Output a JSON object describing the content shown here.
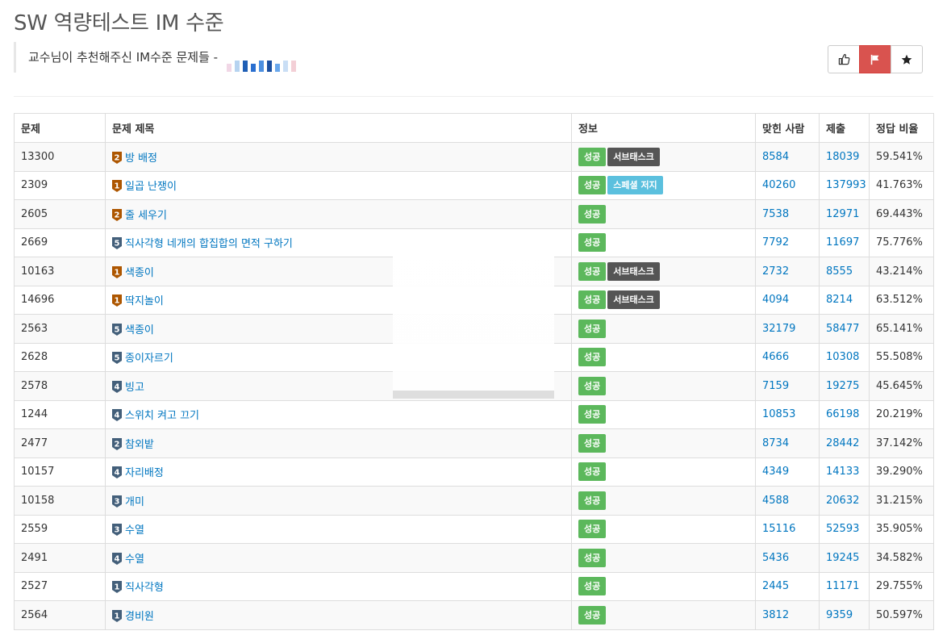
{
  "title": "SW 역량테스트 IM 수준",
  "description": "교수님이 추천해주신 IM수준 문제들 -",
  "redacted_colors": [
    "#f1d7e6",
    "#b6d3f0",
    "#1f5fb5",
    "#2a6fd0",
    "#4c8fe0",
    "#1b4fa0",
    "#6aa8ec",
    "#c9def5",
    "#f3cfd6"
  ],
  "actions": {
    "like_icon": "thumbs-up-icon",
    "flag_icon": "flag-icon",
    "star_icon": "star-icon",
    "flag_color": "#d9534f"
  },
  "columns": [
    "문제",
    "문제 제목",
    "정보",
    "맞힌 사람",
    "제출",
    "정답 비율"
  ],
  "tier_colors": {
    "bronze": "#ad5600",
    "silver": "#435f7a"
  },
  "problems": [
    {
      "id": "13300",
      "tier": "bronze",
      "level": "2",
      "title": "방 배정",
      "tags": [
        "성공",
        "서브태스크"
      ],
      "solved": "8584",
      "submissions": "18039",
      "ratio": "59.541%"
    },
    {
      "id": "2309",
      "tier": "bronze",
      "level": "1",
      "title": "일곱 난쟁이",
      "tags": [
        "성공",
        "스페셜 저지"
      ],
      "solved": "40260",
      "submissions": "137993",
      "ratio": "41.763%"
    },
    {
      "id": "2605",
      "tier": "bronze",
      "level": "2",
      "title": "줄 세우기",
      "tags": [
        "성공"
      ],
      "solved": "7538",
      "submissions": "12971",
      "ratio": "69.443%"
    },
    {
      "id": "2669",
      "tier": "silver",
      "level": "5",
      "title": "직사각형 네개의 합집합의 면적 구하기",
      "tags": [
        "성공"
      ],
      "solved": "7792",
      "submissions": "11697",
      "ratio": "75.776%"
    },
    {
      "id": "10163",
      "tier": "bronze",
      "level": "1",
      "title": "색종이",
      "tags": [
        "성공",
        "서브태스크"
      ],
      "solved": "2732",
      "submissions": "8555",
      "ratio": "43.214%"
    },
    {
      "id": "14696",
      "tier": "bronze",
      "level": "1",
      "title": "딱지놀이",
      "tags": [
        "성공",
        "서브태스크"
      ],
      "solved": "4094",
      "submissions": "8214",
      "ratio": "63.512%"
    },
    {
      "id": "2563",
      "tier": "silver",
      "level": "5",
      "title": "색종이",
      "tags": [
        "성공"
      ],
      "solved": "32179",
      "submissions": "58477",
      "ratio": "65.141%"
    },
    {
      "id": "2628",
      "tier": "silver",
      "level": "5",
      "title": "종이자르기",
      "tags": [
        "성공"
      ],
      "solved": "4666",
      "submissions": "10308",
      "ratio": "55.508%"
    },
    {
      "id": "2578",
      "tier": "silver",
      "level": "4",
      "title": "빙고",
      "tags": [
        "성공"
      ],
      "solved": "7159",
      "submissions": "19275",
      "ratio": "45.645%"
    },
    {
      "id": "1244",
      "tier": "silver",
      "level": "4",
      "title": "스위치 켜고 끄기",
      "tags": [
        "성공"
      ],
      "solved": "10853",
      "submissions": "66198",
      "ratio": "20.219%"
    },
    {
      "id": "2477",
      "tier": "silver",
      "level": "2",
      "title": "참외밭",
      "tags": [
        "성공"
      ],
      "solved": "8734",
      "submissions": "28442",
      "ratio": "37.142%"
    },
    {
      "id": "10157",
      "tier": "silver",
      "level": "4",
      "title": "자리배정",
      "tags": [
        "성공"
      ],
      "solved": "4349",
      "submissions": "14133",
      "ratio": "39.290%"
    },
    {
      "id": "10158",
      "tier": "silver",
      "level": "3",
      "title": "개미",
      "tags": [
        "성공"
      ],
      "solved": "4588",
      "submissions": "20632",
      "ratio": "31.215%"
    },
    {
      "id": "2559",
      "tier": "silver",
      "level": "3",
      "title": "수열",
      "tags": [
        "성공"
      ],
      "solved": "15116",
      "submissions": "52593",
      "ratio": "35.905%"
    },
    {
      "id": "2491",
      "tier": "silver",
      "level": "4",
      "title": "수열",
      "tags": [
        "성공"
      ],
      "solved": "5436",
      "submissions": "19245",
      "ratio": "34.582%"
    },
    {
      "id": "2527",
      "tier": "silver",
      "level": "1",
      "title": "직사각형",
      "tags": [
        "성공"
      ],
      "solved": "2445",
      "submissions": "11171",
      "ratio": "29.755%"
    },
    {
      "id": "2564",
      "tier": "silver",
      "level": "1",
      "title": "경비원",
      "tags": [
        "성공"
      ],
      "solved": "3812",
      "submissions": "9359",
      "ratio": "50.597%"
    }
  ]
}
